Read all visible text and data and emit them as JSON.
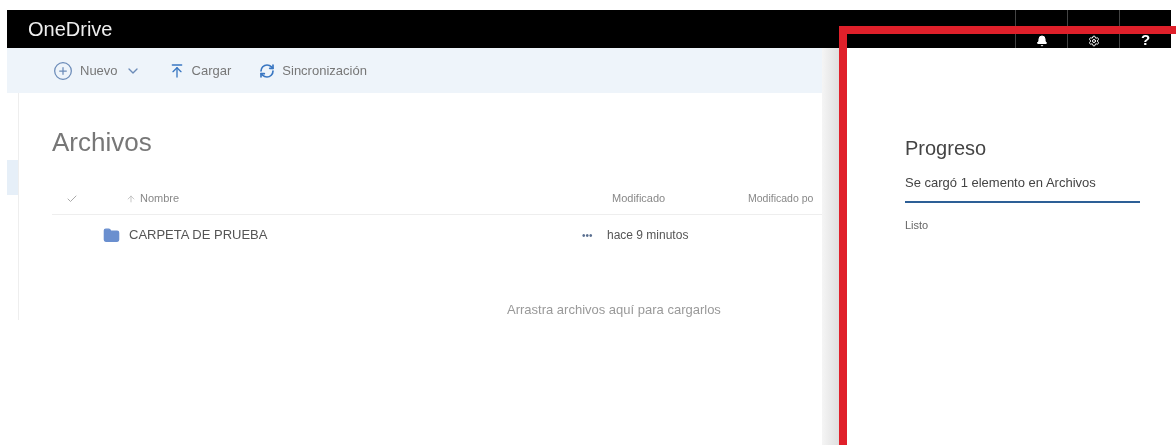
{
  "header": {
    "title": "OneDrive",
    "buttons": [
      {
        "kind": "bell"
      },
      {
        "kind": "gear"
      },
      {
        "kind": "text",
        "label": "?"
      }
    ]
  },
  "toolbar": [
    {
      "kind": "new",
      "label": "Nuevo"
    },
    {
      "kind": "upload",
      "label": "Cargar"
    },
    {
      "kind": "sync",
      "label": "Sincronización"
    }
  ],
  "page_title": "Archivos",
  "table": {
    "columns": [
      "Nombre",
      "Modificado",
      "Modificado po"
    ],
    "rows": [
      {
        "name": "CARPETA DE PRUEBA",
        "more": "•••",
        "modified": "hace 9 minutos"
      }
    ]
  },
  "drop_hint": "Arrastra archivos aquí para cargarlos",
  "progress_panel": {
    "title": "Progreso",
    "message": "Se cargó 1 elemento en Archivos",
    "status": "Listo"
  }
}
